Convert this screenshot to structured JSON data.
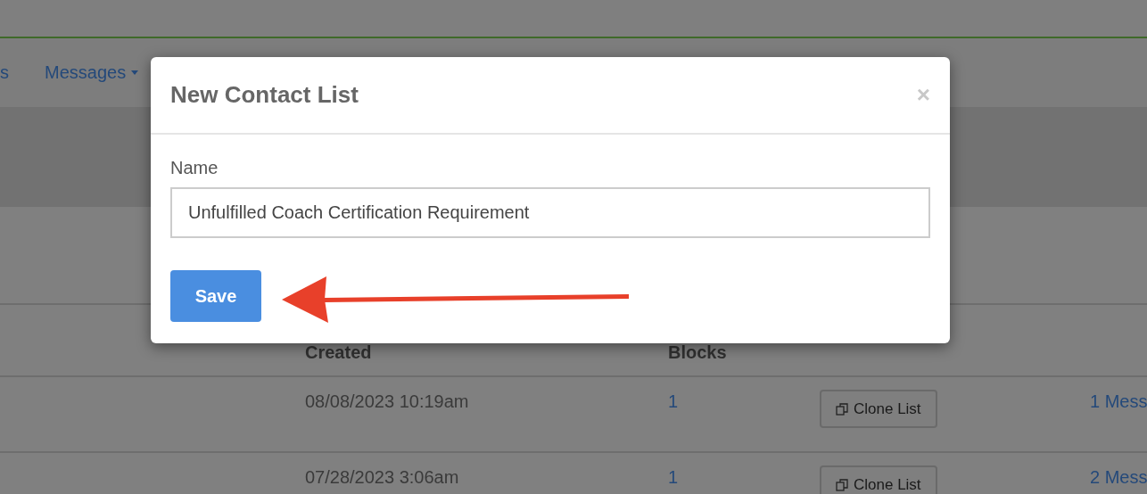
{
  "nav": {
    "items": [
      {
        "label": "s",
        "dropdown": false
      },
      {
        "label": "Messages",
        "dropdown": true
      }
    ]
  },
  "table": {
    "columns": [
      "Created",
      "Blocks"
    ],
    "rows": [
      {
        "created": "08/08/2023 10:19am",
        "blocks": "1",
        "action": "Clone List",
        "messages": "1 Mess"
      },
      {
        "created": "07/28/2023 3:06am",
        "blocks": "1",
        "action": "Clone List",
        "messages": "2 Mess"
      }
    ]
  },
  "modal": {
    "title": "New Contact List",
    "close": "×",
    "field_label": "Name",
    "field_value": "Unfulfilled Coach Certification Requirement",
    "button": "Save"
  }
}
